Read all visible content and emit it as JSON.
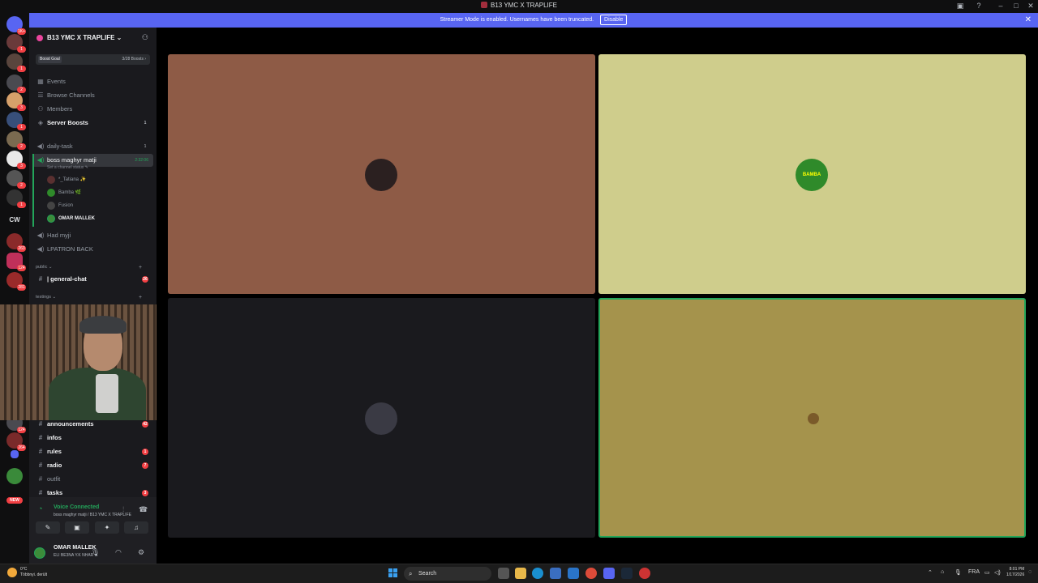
{
  "window": {
    "title": "B13 YMC X TRAPLIFE",
    "controls": {
      "minimize": "–",
      "maximize": "□",
      "close": "✕"
    }
  },
  "banner": {
    "text": "Streamer Mode is enabled. Usernames have been truncated.",
    "disable_label": "Disable",
    "close_icon": "✕",
    "color": "#5865f2"
  },
  "rail": {
    "badges": [
      "1K+",
      "1",
      "1",
      "2",
      "3",
      "1",
      "2",
      "3",
      "2",
      "1",
      "263",
      "124",
      "281",
      "124",
      "264"
    ],
    "cw_label": "CW",
    "new_label": "NEW"
  },
  "server": {
    "name": "B13 YMC X TRAPLIFE",
    "boost_goal": "Boost Goal",
    "boost_count": "3/28 Boosts"
  },
  "channels": {
    "events": "Events",
    "browse": "Browse Channels",
    "members": "Members",
    "server_boosts": "Server Boosts",
    "server_boosts_count": "1",
    "daily_task": "daily-task",
    "daily_task_count": "1",
    "voice_active": "boss maghyr matji",
    "voice_timer": "2:32:06",
    "status_hint": "Set a channel status",
    "voice_users": [
      "*_Tatiana ✨",
      "Bamba 🌿",
      "Fusion",
      "OMAR MALLEK"
    ],
    "had_myji": "Had myji",
    "lpatron": "LPATRON BACK",
    "cat_public": "public",
    "general_chat": "| general-chat",
    "general_count": "26",
    "cat_testings": "testings",
    "announcements": "announcements",
    "announcements_count": "42",
    "infos": "infos",
    "rules": "rules",
    "rules_count": "1",
    "radio": "radio",
    "radio_count": "7",
    "outfit": "outfit",
    "tasks": "tasks",
    "tasks_count": "3"
  },
  "voice_panel": {
    "status": "Voice Connected",
    "channel": "boss maghyr matji / B13 YMC X TRAPLIFE"
  },
  "user": {
    "name": "OMAR MALLEK",
    "status": "ELI BE3NA Y.K NHAR ..."
  },
  "tiles": [
    {
      "bg": "#8e5b46",
      "avatar_color": "#2b2020",
      "speaking": false
    },
    {
      "bg": "#cfcd8c",
      "avatar_color": "#2f8a2a",
      "avatar_text": "BAMBA",
      "speaking": false
    },
    {
      "bg": "#1a1a1e",
      "avatar_color": "#3a3a44",
      "speaking": false
    },
    {
      "bg": "#a5934c",
      "avatar_color": "#7a5a2a",
      "speaking": true
    }
  ],
  "taskbar": {
    "temp": "0°C",
    "weather": "Többnyi. derült",
    "search": "Search",
    "lang": "FRA",
    "time": "8:01 PM",
    "date": "1/17/2026"
  }
}
